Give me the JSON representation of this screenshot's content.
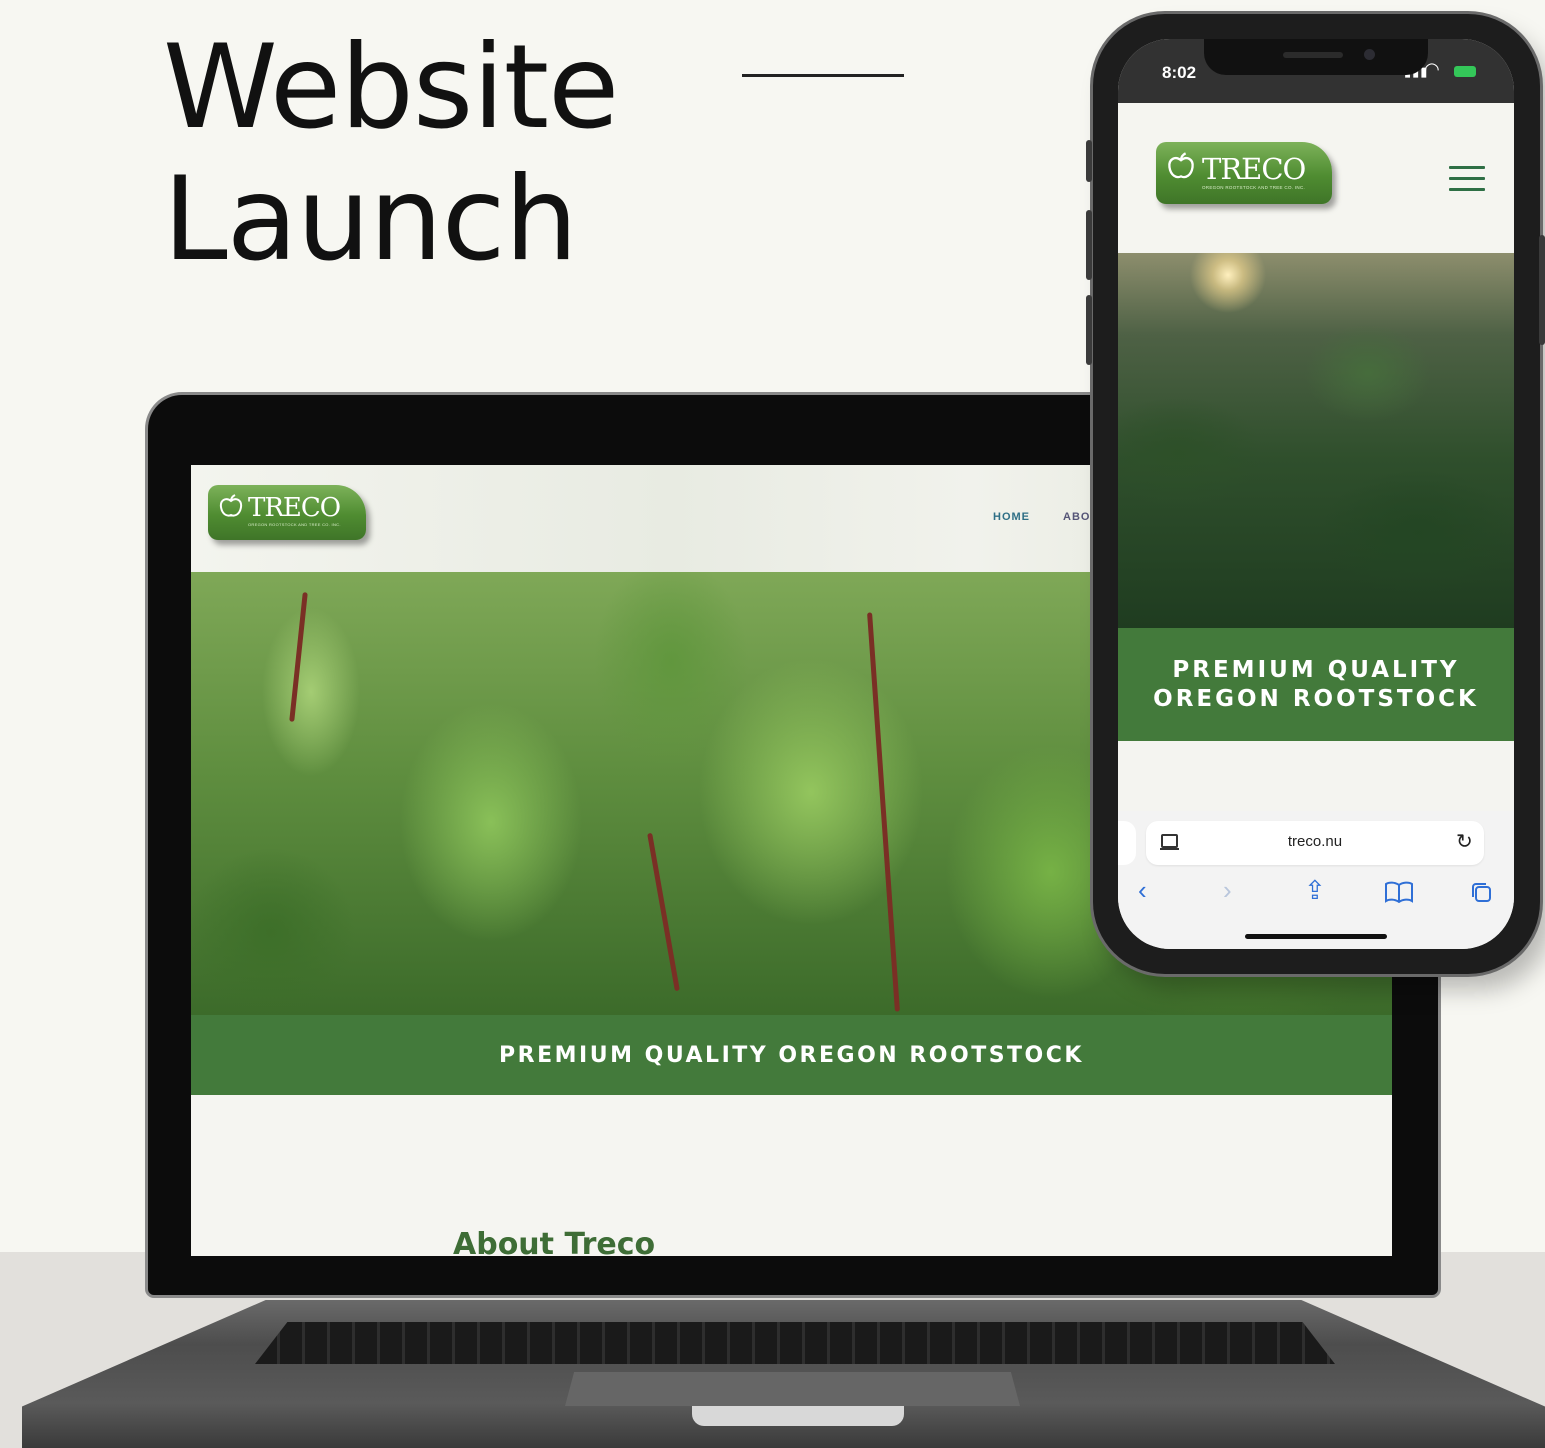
{
  "headline": {
    "line1": "Website",
    "line2": "Launch"
  },
  "laptop_site": {
    "logo_text": "TRECO",
    "logo_tagline": "OREGON ROOTSTOCK AND TREE CO. INC.",
    "nav": {
      "home": "HOME",
      "about": "ABO"
    },
    "banner": "PREMIUM QUALITY OREGON ROOTSTOCK",
    "section_heading": "About Treco"
  },
  "phone": {
    "status": {
      "time": "8:02",
      "signal": "▮▮▮",
      "wifi": "◠",
      "battery_color": "#34c759"
    },
    "site": {
      "logo_text": "TRECO",
      "logo_tagline": "OREGON ROOTSTOCK AND TREE CO. INC.",
      "banner_line1": "PREMIUM QUALITY",
      "banner_line2": "OREGON ROOTSTOCK"
    },
    "browser": {
      "url": "treco.nu",
      "icons": [
        "page-menu-icon",
        "reload-icon",
        "back-icon",
        "forward-icon",
        "share-icon",
        "bookmarks-icon",
        "tabs-icon"
      ],
      "back": "‹",
      "forward": "›",
      "share": "⇪",
      "bookmarks": "📖",
      "tabs": "⧉",
      "reload": "↻"
    }
  },
  "colors": {
    "brand_green": "#437a3b",
    "logo_green": "#4f8c31",
    "nav_blue": "#2f6f86",
    "link_blue": "#2f6fd6"
  }
}
